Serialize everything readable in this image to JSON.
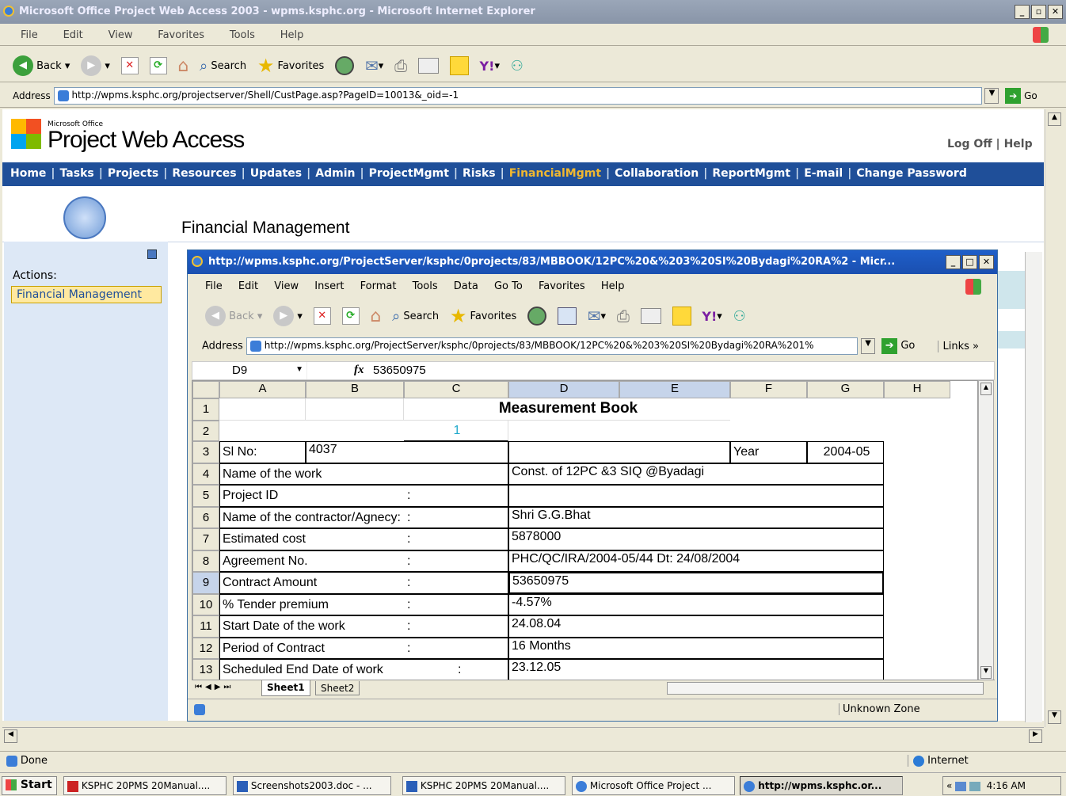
{
  "ie": {
    "title": "Microsoft Office Project Web Access 2003 - wpms.ksphc.org - Microsoft Internet Explorer",
    "menu": [
      "File",
      "Edit",
      "View",
      "Favorites",
      "Tools",
      "Help"
    ],
    "back": "Back",
    "search": "Search",
    "favorites": "Favorites",
    "address_label": "Address",
    "address": "http://wpms.ksphc.org/projectserver/Shell/CustPage.asp?PageID=10013&_oid=-1",
    "go": "Go",
    "status": "Done",
    "zone": "Internet"
  },
  "pwa": {
    "brand_small": "Microsoft Office",
    "brand": "Project Web Access",
    "logoff": "Log Off",
    "help": "Help",
    "nav": [
      "Home",
      "Tasks",
      "Projects",
      "Resources",
      "Updates",
      "Admin",
      "ProjectMgmt",
      "Risks",
      "FinancialMgmt",
      "Collaboration",
      "ReportMgmt",
      "E-mail",
      "Change Password"
    ],
    "page_title": "Financial Management",
    "actions_label": "Actions:",
    "actions_item": "Financial Management"
  },
  "popup": {
    "title": "http://wpms.ksphc.org/ProjectServer/ksphc/0projects/83/MBBOOK/12PC%20&%203%20SI%20Bydagi%20RA%2 - Micr...",
    "menu": [
      "File",
      "Edit",
      "View",
      "Insert",
      "Format",
      "Tools",
      "Data",
      "Go To",
      "Favorites",
      "Help"
    ],
    "back": "Back",
    "search": "Search",
    "favorites": "Favorites",
    "address_label": "Address",
    "address": "http://wpms.ksphc.org/ProjectServer/ksphc/0projects/83/MBBOOK/12PC%20&%203%20SI%20Bydagi%20RA%201%",
    "go": "Go",
    "links": "Links",
    "namebox": "D9",
    "fx": "fx",
    "formula": "53650975",
    "zone": "Unknown Zone",
    "sheets": [
      "Sheet1",
      "Sheet2"
    ]
  },
  "sheet": {
    "columns": [
      "A",
      "B",
      "C",
      "D",
      "E",
      "F",
      "G",
      "H"
    ],
    "rows": [
      "1",
      "2",
      "3",
      "4",
      "5",
      "6",
      "7",
      "8",
      "9",
      "10",
      "11",
      "12",
      "13"
    ],
    "title": "Measurement Book",
    "c2": "1",
    "slno_label": "Sl No:",
    "slno": "4037",
    "year_label": "Year",
    "year": "2004-05",
    "labels": [
      "Name of the work",
      "Project ID",
      "Name of the contractor/Agnecy:",
      "Estimated cost",
      "Agreement No.",
      "Contract Amount",
      "% Tender premium",
      "Start Date of the work",
      "Period of Contract",
      "Scheduled End Date of  work"
    ],
    "colons": [
      "",
      ":",
      ":",
      ":",
      ":",
      ":",
      ":",
      ":",
      ":",
      ":"
    ],
    "values": [
      "Const. of 12PC &3 SIQ @Byadagi",
      "",
      "Shri G.G.Bhat",
      "5878000",
      "PHC/QC/IRA/2004-05/44 Dt: 24/08/2004",
      "53650975",
      "-4.57%",
      "24.08.04",
      "16 Months",
      "23.12.05"
    ]
  },
  "taskbar": {
    "start": "Start",
    "items": [
      "KSPHC 20PMS 20Manual....",
      "Screenshots2003.doc - ...",
      "KSPHC 20PMS 20Manual....",
      "Microsoft Office Project ...",
      "http://wpms.ksphc.or..."
    ],
    "clock": "4:16 AM"
  }
}
